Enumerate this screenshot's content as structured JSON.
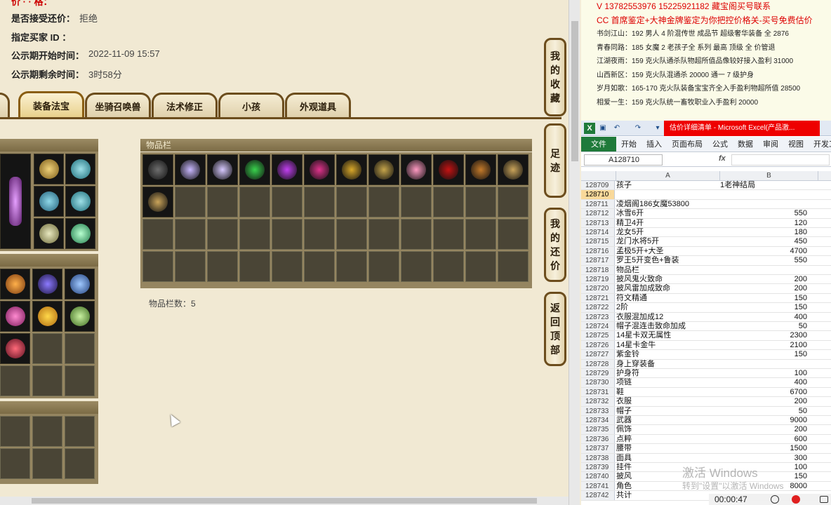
{
  "game": {
    "info": [
      {
        "label": "是否接受还价：",
        "value": "拒绝"
      },
      {
        "label": "指定买家 ID ：",
        "value": ""
      },
      {
        "label": "公示期开始时间：",
        "value": "2022-11-09 15:57"
      },
      {
        "label": "公示期剩余时间：",
        "value": "3时58分"
      }
    ],
    "tabs": [
      "装备法宝",
      "坐骑召唤兽",
      "法术修正",
      "小孩",
      "外观道具"
    ],
    "active_tab": "装备法宝",
    "inventory_header": "物品栏",
    "item_count_text": "物品栏数：5",
    "side_buttons": [
      "我的收藏",
      "足迹",
      "我的还价",
      "返回顶部"
    ],
    "inventory_colors": [
      "#6e6e6e",
      "#c9b8ff",
      "#d7c9ff",
      "#39d24d",
      "#c13ff0",
      "#e0338c",
      "#d9a82a",
      "#c6a54a",
      "#ff9ac2",
      "#c41313",
      "#c47a2a",
      "#caa45a",
      "#caa45a"
    ]
  },
  "notes": {
    "lines": [
      {
        "text": "V 13782553976    15225921182   藏宝阁买号联系",
        "red": true
      },
      {
        "text": "CC 首席鉴定+大神金牌鉴定为你把控价格关-买号免费估价",
        "red": true
      },
      {
        "text": "书剑江山：192 男人 4 阶混传世 成品节 超级奢华装备 全 2876",
        "red": false
      },
      {
        "text": "青春同路：185 女魔 2 老孩子全 系列 最高 顶级 全 价管退",
        "red": false
      },
      {
        "text": "江湖夜雨：159 克火队通杀队物超所值品像较好接入盈利 31000",
        "red": false
      },
      {
        "text": "山西新区：159 克火队混通杀 20000 通一 7 级护身",
        "red": false
      },
      {
        "text": "岁月如歌：165-170 克火队装备宝宝齐全入手盈利物超所值 28500",
        "red": false
      },
      {
        "text": "相爱一生：159 克火队统一畜牧职业入手盈利 20000",
        "red": false
      }
    ]
  },
  "excel": {
    "title": "估价详细清单 - Microsoft Excel(产品激...",
    "ribbon_tabs": [
      "文件",
      "开始",
      "插入",
      "页面布局",
      "公式",
      "数据",
      "审阅",
      "视图",
      "开发工"
    ],
    "name_box": "A128710",
    "fx_symbol": "fx",
    "col_headers": [
      "A",
      "B"
    ],
    "rows": [
      {
        "n": "128709",
        "a": "孩子",
        "b": "1老神结局",
        "b_left": true
      },
      {
        "n": "128710",
        "a": "",
        "b": ""
      },
      {
        "n": "128711",
        "a": "凌烟阁186女魔53800",
        "b": ""
      },
      {
        "n": "128712",
        "a": "冰雪6开",
        "b": "550"
      },
      {
        "n": "128713",
        "a": "精卫4开",
        "b": "120"
      },
      {
        "n": "128714",
        "a": "龙女5开",
        "b": "180"
      },
      {
        "n": "128715",
        "a": "龙门水将5开",
        "b": "450"
      },
      {
        "n": "128716",
        "a": "孟极5开+大圣",
        "b": "4700"
      },
      {
        "n": "128717",
        "a": "罗王5开变色+鲁装",
        "b": "550"
      },
      {
        "n": "128718",
        "a": "物品栏",
        "b": ""
      },
      {
        "n": "128719",
        "a": "披风鬼火致命",
        "b": "200"
      },
      {
        "n": "128720",
        "a": "披风雷加成致命",
        "b": "200"
      },
      {
        "n": "128721",
        "a": "符文精通",
        "b": "150"
      },
      {
        "n": "128722",
        "a": "2阶",
        "b": "150"
      },
      {
        "n": "128723",
        "a": "衣服混加成12",
        "b": "400"
      },
      {
        "n": "128724",
        "a": "帽子混连击致命加成",
        "b": "50"
      },
      {
        "n": "128725",
        "a": "14星卡双无属性",
        "b": "2300"
      },
      {
        "n": "128726",
        "a": "14星卡金牛",
        "b": "2100"
      },
      {
        "n": "128727",
        "a": "紫金铃",
        "b": "150"
      },
      {
        "n": "128728",
        "a": "身上穿装备",
        "b": ""
      },
      {
        "n": "128729",
        "a": "护身符",
        "b": "100"
      },
      {
        "n": "128730",
        "a": "项链",
        "b": "400"
      },
      {
        "n": "128731",
        "a": "鞋",
        "b": "6700"
      },
      {
        "n": "128732",
        "a": "衣服",
        "b": "200"
      },
      {
        "n": "128733",
        "a": "帽子",
        "b": "50"
      },
      {
        "n": "128734",
        "a": "武器",
        "b": "9000"
      },
      {
        "n": "128735",
        "a": "佩饰",
        "b": "200"
      },
      {
        "n": "128736",
        "a": "点粹",
        "b": "600"
      },
      {
        "n": "128737",
        "a": "腰带",
        "b": "1500"
      },
      {
        "n": "128738",
        "a": "面具",
        "b": "300"
      },
      {
        "n": "128739",
        "a": "挂件",
        "b": "100"
      },
      {
        "n": "128740",
        "a": "披风",
        "b": "150"
      },
      {
        "n": "128741",
        "a": "角色",
        "b": "8000"
      },
      {
        "n": "128742",
        "a": "共计",
        "b": ""
      }
    ],
    "selected_row": "128710"
  },
  "watermark": {
    "line1": "激活 Windows",
    "line2": "转到\"设置\"以激活 Windows"
  },
  "recorder": {
    "time": "00:00:47"
  }
}
